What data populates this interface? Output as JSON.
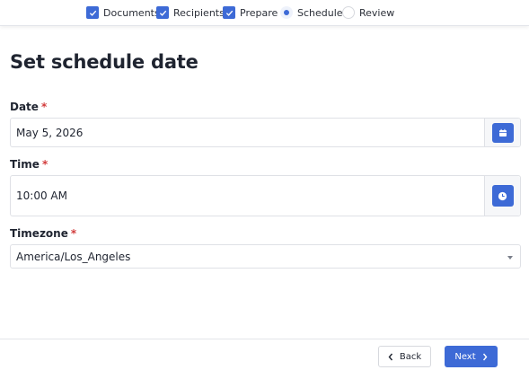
{
  "stepper": {
    "steps": [
      {
        "label": "Documents",
        "state": "done"
      },
      {
        "label": "Recipients",
        "state": "done"
      },
      {
        "label": "Prepare",
        "state": "done"
      },
      {
        "label": "Schedule",
        "state": "active"
      },
      {
        "label": "Review",
        "state": "pending"
      }
    ]
  },
  "page": {
    "title": "Set schedule date"
  },
  "form": {
    "date": {
      "label": "Date",
      "required_mark": "*",
      "value": "May 5, 2026",
      "icon": "calendar-icon"
    },
    "time": {
      "label": "Time",
      "required_mark": "*",
      "value": "10:00 AM",
      "icon": "clock-icon"
    },
    "timezone": {
      "label": "Timezone",
      "required_mark": "*",
      "value": "America/Los_Angeles"
    }
  },
  "footer": {
    "back_label": "Back",
    "next_label": "Next"
  },
  "colors": {
    "accent": "#3d6ad6",
    "required": "#d23b3b"
  }
}
